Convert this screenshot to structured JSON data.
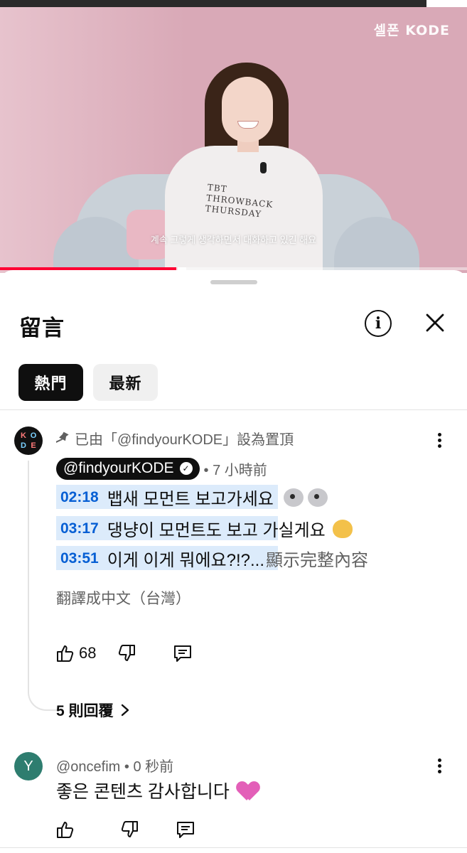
{
  "video": {
    "brand_logo": "셀폰 KODE",
    "subtitle": "계속 그렇게 생각하면서 대화하고 있긴 해요",
    "shirt_print": "TBT THROWBACK THURSDAY",
    "progress_fraction": 0.38
  },
  "comments_panel": {
    "title": "留言",
    "info_icon": "info-circle-icon",
    "close_icon": "close-icon",
    "tabs": [
      {
        "label": "熱門",
        "selected": true
      },
      {
        "label": "最新",
        "selected": false
      }
    ]
  },
  "pinned_comment": {
    "avatar_text": [
      "K",
      "O",
      "D",
      "E"
    ],
    "pinned_label": "已由「@findyourKODE」設為置頂",
    "author": "@findyourKODE",
    "verified": true,
    "time": "• 7 小時前",
    "lines": [
      {
        "timestamp": "02:18",
        "text": "뱁새 모먼트 보고가세요"
      },
      {
        "timestamp": "03:17",
        "text": "댕냥이 모먼트도 보고 가실게요"
      },
      {
        "timestamp": "03:51",
        "text": "이게 이게 뭐에요?!?..."
      }
    ],
    "show_more": "顯示完整內容",
    "translate": "翻譯成中文（台灣）",
    "likes": "68",
    "replies_label": "5 則回覆"
  },
  "second_comment": {
    "avatar_letter": "Y",
    "author": "@oncefim",
    "time": "• 0 秒前",
    "text": "좋은 콘텐츠 감사합니다"
  },
  "colors": {
    "accent_blue": "#065fd4",
    "timestamp_highlight": "#dcebfb",
    "progress_red": "#ff0033",
    "video_bg_pink": "#d9a9b7"
  }
}
